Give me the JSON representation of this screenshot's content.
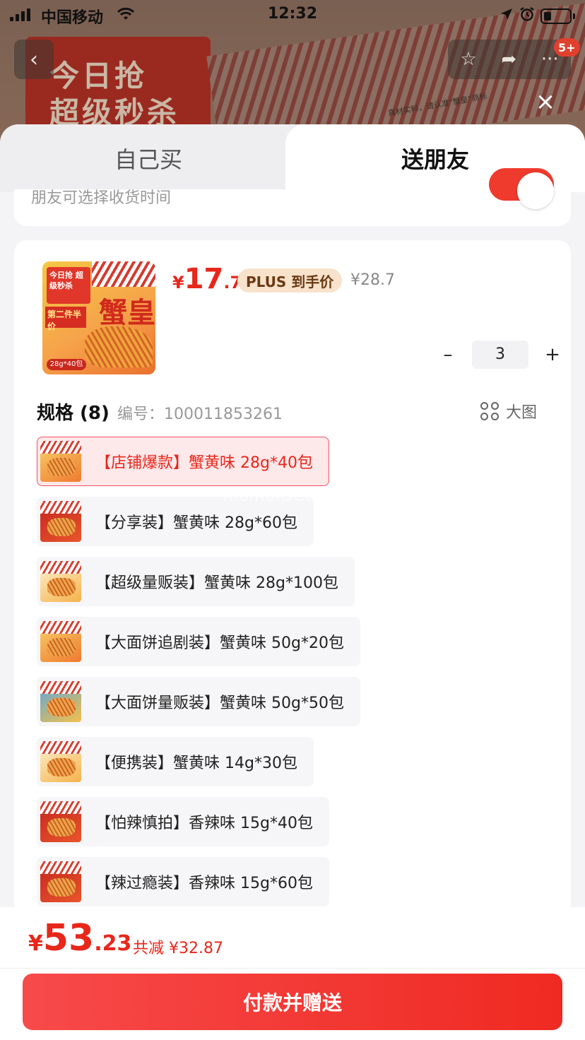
{
  "status_bar": {
    "carrier": "中国移动",
    "time": "12:32",
    "wifi_icon": "wifi-icon",
    "location_icon": "location-arrow-icon",
    "alarm_icon": "alarm-icon"
  },
  "background": {
    "banner_text_line1": "今日抢",
    "banner_text_line2": "超级秒杀",
    "note": "真材实料，请认准\"蟹皇\"商标",
    "cart_badge": "5+"
  },
  "tabs": {
    "self": "自己买",
    "gift": "送朋友"
  },
  "gift_option": {
    "text": "朋友可选择收货时间"
  },
  "product": {
    "image_badge_top": "今日抢 超级秒杀",
    "image_title": "蟹皇",
    "image_half": "第二件半价",
    "image_tag": "28g*40包",
    "price_yen": "¥",
    "price_int": "17",
    "price_dec": ".74",
    "plus_label": "PLUS 到手价",
    "original_price": "¥28.7",
    "quantity": "3"
  },
  "spec": {
    "title": "规格 (8)",
    "number": "编号：100011853261",
    "big_image": "大图",
    "items": [
      {
        "label": "【店铺爆款】蟹黄味 28g*40包",
        "selected": true
      },
      {
        "label": "【分享装】蟹黄味 28g*60包",
        "selected": false
      },
      {
        "label": "【超级量贩装】蟹黄味 28g*100包",
        "selected": false
      },
      {
        "label": "【大面饼追剧装】蟹黄味 50g*20包",
        "selected": false
      },
      {
        "label": "【大面饼量贩装】蟹黄味 50g*50包",
        "selected": false
      },
      {
        "label": "【便携装】蟹黄味 14g*30包",
        "selected": false
      },
      {
        "label": "【怕辣慎拍】香辣味 15g*40包",
        "selected": false
      },
      {
        "label": "【辣过瘾装】香辣味 15g*60包",
        "selected": false
      }
    ]
  },
  "watermark": "momoIDCO",
  "footer": {
    "total_yen": "¥",
    "total_int": "53",
    "total_dec": ".23",
    "saving": "共减 ¥32.87",
    "pay_button": "付款并赠送"
  },
  "colors": {
    "accent": "#e8271b",
    "button": "#ef2a22",
    "selected_bg": "#fde8ea",
    "selected_border": "#f25063"
  }
}
